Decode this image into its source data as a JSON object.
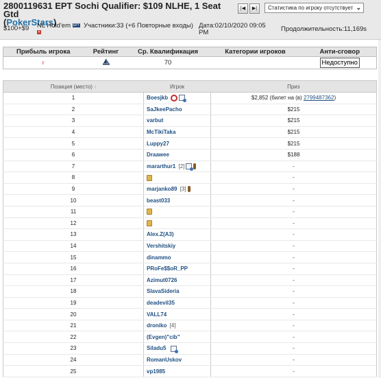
{
  "header": {
    "title_main": "2800119631 EPT Sochi Qualifier: $109 NLHE, 1 Seat Gtd",
    "site_open": "(",
    "site": "PokerStars",
    "site_close": ")",
    "buyin": "$100+$9",
    "game": "NL Hold'em",
    "game_badge_ept": "EPT",
    "game_badge_x": "✕",
    "participants": "Участники:33 (+6 Повторные входы)",
    "date": "Дата:02/10/2020 09:05 PM",
    "duration": "Продолжительность:11,169s",
    "nav_first_label": "|◀",
    "nav_next_label": "▶|",
    "stats_select": "Статистика по игроку отсутствует"
  },
  "summary": {
    "columns": [
      "Прибыль игрока",
      "Рейтинг",
      "Ср. Квалификация",
      "Категории игроков",
      "Анти-сговор"
    ],
    "profit": "r",
    "rating_icon": "ship-icon",
    "avg_qualification": "70",
    "anti_collusion_button": "Недоступно"
  },
  "results": {
    "columns": [
      "Позиция (место)",
      "Игрок",
      "Приз"
    ],
    "sort_indicator": "↑",
    "rows": [
      {
        "pos": "1",
        "player": "Boesjkb",
        "prize": "$2,852 (билет на (в) ",
        "ticket": "2799487362",
        "prize_close": ")",
        "icons": [
          "target-icon",
          "sheet-icon"
        ],
        "count": ""
      },
      {
        "pos": "2",
        "player": "SaJkeePacho",
        "prize": "$215",
        "ticket": "",
        "prize_close": "",
        "icons": [],
        "count": ""
      },
      {
        "pos": "3",
        "player": "varbut",
        "prize": "$215",
        "ticket": "",
        "prize_close": "",
        "icons": [],
        "count": ""
      },
      {
        "pos": "4",
        "player": "McTikiTaka",
        "prize": "$215",
        "ticket": "",
        "prize_close": "",
        "icons": [],
        "count": ""
      },
      {
        "pos": "5",
        "player": "Luppy27",
        "prize": "$215",
        "ticket": "",
        "prize_close": "",
        "icons": [],
        "count": ""
      },
      {
        "pos": "6",
        "player": "Draawee",
        "prize": "$188",
        "ticket": "",
        "prize_close": "",
        "icons": [],
        "count": ""
      },
      {
        "pos": "7",
        "player": "mararthur1",
        "prize": "-",
        "ticket": "",
        "prize_close": "",
        "icons": [
          "sheet-icon",
          "bottle-icon"
        ],
        "count": "[2]"
      },
      {
        "pos": "8",
        "player": "",
        "prize": "-",
        "ticket": "",
        "prize_close": "",
        "icons": [
          "lock-icon"
        ],
        "count": ""
      },
      {
        "pos": "9",
        "player": "marjanko89",
        "prize": "-",
        "ticket": "",
        "prize_close": "",
        "icons": [
          "bottle-icon"
        ],
        "count": "[3]"
      },
      {
        "pos": "10",
        "player": "beast033",
        "prize": "-",
        "ticket": "",
        "prize_close": "",
        "icons": [],
        "count": ""
      },
      {
        "pos": "11",
        "player": "",
        "prize": "-",
        "ticket": "",
        "prize_close": "",
        "icons": [
          "lock-icon"
        ],
        "count": ""
      },
      {
        "pos": "12",
        "player": "",
        "prize": "-",
        "ticket": "",
        "prize_close": "",
        "icons": [
          "lock-icon"
        ],
        "count": ""
      },
      {
        "pos": "13",
        "player": "Alex.Z(A3)",
        "prize": "-",
        "ticket": "",
        "prize_close": "",
        "icons": [],
        "count": ""
      },
      {
        "pos": "14",
        "player": "Vershitskiy",
        "prize": "-",
        "ticket": "",
        "prize_close": "",
        "icons": [],
        "count": ""
      },
      {
        "pos": "15",
        "player": "dinammo",
        "prize": "-",
        "ticket": "",
        "prize_close": "",
        "icons": [],
        "count": ""
      },
      {
        "pos": "16",
        "player": "PRoFe$$oR_PP",
        "prize": "-",
        "ticket": "",
        "prize_close": "",
        "icons": [],
        "count": ""
      },
      {
        "pos": "17",
        "player": "Azimut0726",
        "prize": "-",
        "ticket": "",
        "prize_close": "",
        "icons": [],
        "count": ""
      },
      {
        "pos": "18",
        "player": "SlavaSideria",
        "prize": "-",
        "ticket": "",
        "prize_close": "",
        "icons": [],
        "count": ""
      },
      {
        "pos": "19",
        "player": "deadevil35",
        "prize": "-",
        "ticket": "",
        "prize_close": "",
        "icons": [],
        "count": ""
      },
      {
        "pos": "20",
        "player": "VALL74",
        "prize": "-",
        "ticket": "",
        "prize_close": "",
        "icons": [],
        "count": ""
      },
      {
        "pos": "21",
        "player": "droniko",
        "prize": "-",
        "ticket": "",
        "prize_close": "",
        "icons": [],
        "count": "[4]"
      },
      {
        "pos": "22",
        "player": "(Evgen)\"cib\"",
        "prize": "-",
        "ticket": "",
        "prize_close": "",
        "icons": [],
        "count": ""
      },
      {
        "pos": "23",
        "player": "Siladu5",
        "prize": "-",
        "ticket": "",
        "prize_close": "",
        "icons": [
          "sheet-icon"
        ],
        "count": ""
      },
      {
        "pos": "24",
        "player": "RomanUskov",
        "prize": "-",
        "ticket": "",
        "prize_close": "",
        "icons": [],
        "count": ""
      },
      {
        "pos": "25",
        "player": "vp1985",
        "prize": "-",
        "ticket": "",
        "prize_close": "",
        "icons": [],
        "count": ""
      }
    ]
  }
}
